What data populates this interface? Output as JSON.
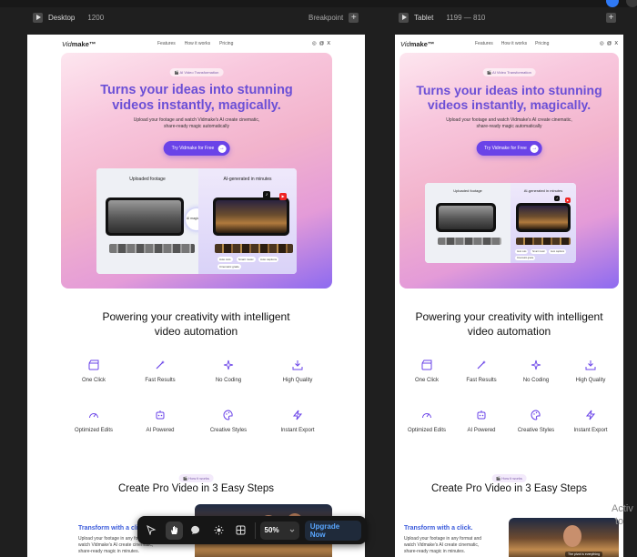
{
  "frames": {
    "desktop": {
      "name": "Desktop",
      "width": "1200",
      "breakpoint_label": "Breakpoint"
    },
    "tablet": {
      "name": "Tablet",
      "size": "1199 — 810"
    }
  },
  "site": {
    "logo_main": "Vid",
    "logo_rest": "make™",
    "nav": [
      "Features",
      "How it works",
      "Pricing"
    ],
    "socials": [
      "instagram-icon",
      "threads-icon",
      "x-icon"
    ],
    "socials_glyphs": [
      "◎",
      "@",
      "X"
    ],
    "hero": {
      "badge": "AI Video Transformation",
      "title_line1": "Turns your ideas into stunning",
      "title_line2": "videos instantly, magically.",
      "sub_line1": "Upload your footage and watch Vidmake's AI create cinematic,",
      "sub_line2": "share-ready magic automatically",
      "cta": "Try Vidmake for Free",
      "showcase": {
        "left_title": "Uploaded footage",
        "right_title": "AI-generated in minutes",
        "magic": "AI magic layer",
        "chips": [
          "Auto cuts",
          "Smart music",
          "Auto captions",
          "Cinematic grade"
        ]
      }
    },
    "powering_line1": "Powering your creativity with intelligent",
    "powering_line2": "video automation",
    "features": [
      {
        "label": "One Click",
        "icon": "clapperboard-icon"
      },
      {
        "label": "Fast Results",
        "icon": "magic-wand-icon"
      },
      {
        "label": "No Coding",
        "icon": "sparkles-icon"
      },
      {
        "label": "High Quality",
        "icon": "download-tray-icon"
      },
      {
        "label": "Optimized Edits",
        "icon": "gauge-icon"
      },
      {
        "label": "AI Powered",
        "icon": "robot-icon"
      },
      {
        "label": "Creative Styles",
        "icon": "palette-icon"
      },
      {
        "label": "Instant Export",
        "icon": "lightning-icon"
      }
    ],
    "how_badge": "How it works",
    "steps_title": "Create Pro Video in 3 Easy Steps",
    "step1_title": "Transform with a click.",
    "step1_text_line1": "Upload your footage in any format and",
    "step1_text_line2": "watch Vidmake's AI create cinematic,",
    "step1_text_line3": "share-ready magic in minutes.",
    "photo_caption": "The pivot is everything"
  },
  "toolbar": {
    "tools": [
      "select-tool",
      "hand-tool",
      "comment-tool",
      "theme-tool",
      "grid-tool"
    ],
    "zoom": "50%",
    "upgrade": "Upgrade Now"
  },
  "watermark": {
    "line1": "Activ",
    "line2": "to"
  },
  "colors": {
    "accent": "#6a43e8",
    "heading": "#6b4fd6",
    "canvas": "#1f1f1f",
    "upgrade": "#59a6ff"
  }
}
